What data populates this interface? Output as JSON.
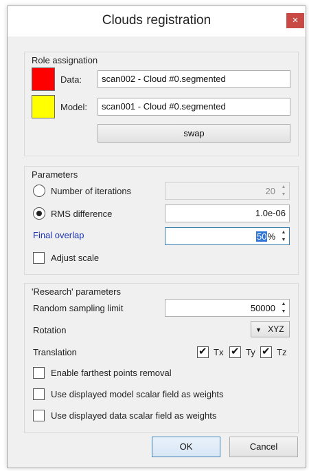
{
  "window": {
    "title": "Clouds registration",
    "close_glyph": "×"
  },
  "role": {
    "group_title": "Role assignation",
    "data_label": "Data:",
    "data_value": "scan002 - Cloud #0.segmented",
    "data_color": "#ff0000",
    "model_label": "Model:",
    "model_value": "scan001 - Cloud #0.segmented",
    "model_color": "#ffff00",
    "swap_label": "swap"
  },
  "parameters": {
    "group_title": "Parameters",
    "iterations_label": "Number of iterations",
    "iterations_value": "20",
    "iterations_checked": false,
    "rms_label": "RMS difference",
    "rms_value": "1.0e-06",
    "rms_checked": true,
    "overlap_label": "Final overlap",
    "overlap_value": "50",
    "overlap_suffix": "%",
    "adjust_scale_label": "Adjust scale",
    "adjust_scale_checked": false
  },
  "research": {
    "group_title": "'Research' parameters",
    "sampling_label": "Random sampling limit",
    "sampling_value": "50000",
    "rotation_label": "Rotation",
    "rotation_value": "XYZ",
    "translation_label": "Translation",
    "tx_label": "Tx",
    "ty_label": "Ty",
    "tz_label": "Tz",
    "farthest_label": "Enable farthest points removal",
    "model_weights_label": "Use displayed model scalar field as weights",
    "data_weights_label": "Use displayed data scalar field as weights"
  },
  "buttons": {
    "ok": "OK",
    "cancel": "Cancel"
  },
  "icons": {
    "close": "close-icon",
    "spin_up": "spin-up-icon",
    "spin_down": "spin-down-icon",
    "dropdown": "dropdown-arrow-icon",
    "check": "checkmark-icon"
  }
}
